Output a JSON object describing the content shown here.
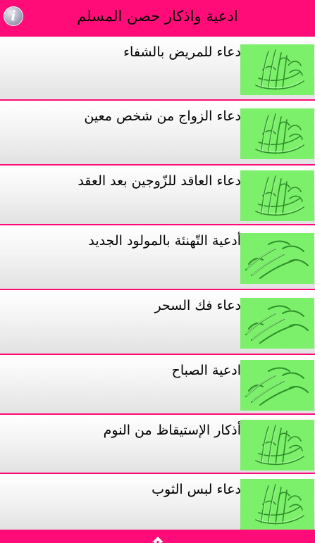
{
  "header": {
    "title": "ادعية واذكار حصن المسلم",
    "info_icon": "info-icon",
    "info_glyph": "i"
  },
  "colors": {
    "accent": "#ff0c78",
    "thumb_bg": "#7cf06a"
  },
  "items": [
    {
      "label": "دعاء للمريض بالشفاء"
    },
    {
      "label": "دعاء الزواج من شخص معين"
    },
    {
      "label": "دعاء العاقد للزّوجين بعد العقد"
    },
    {
      "label": "أدعية التّهنئة بالمولود الجديد"
    },
    {
      "label": "دعاء فك السحر"
    },
    {
      "label": "ادعية الصباح"
    },
    {
      "label": "أذكار الإستيقاظ من النوم"
    },
    {
      "label": "دعاء لبس الثوب"
    }
  ],
  "bottom": {
    "icon": "home-icon"
  }
}
